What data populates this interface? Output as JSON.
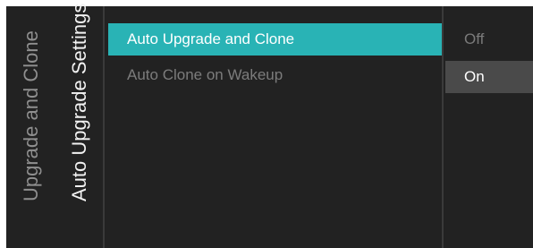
{
  "breadcrumb": {
    "parent": "Upgrade and Clone",
    "current": "Auto Upgrade Settings"
  },
  "menu": {
    "items": [
      {
        "label": "Auto Upgrade and Clone",
        "selected": true
      },
      {
        "label": "Auto Clone on Wakeup",
        "selected": false
      }
    ]
  },
  "options": {
    "items": [
      {
        "label": "Off",
        "highlighted": false
      },
      {
        "label": "On",
        "highlighted": true
      }
    ]
  },
  "colors": {
    "background": "#222222",
    "accent": "#29b3b5",
    "option_highlight": "#4a4a4a"
  }
}
